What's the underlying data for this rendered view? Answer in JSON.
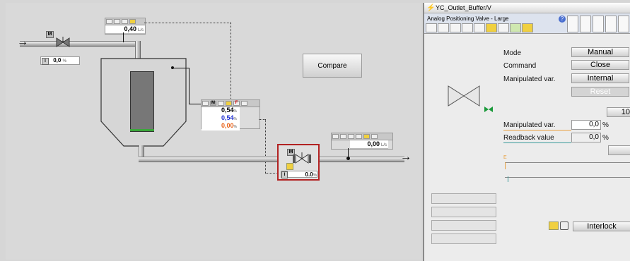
{
  "process": {
    "valve_inlet_mode": "M",
    "valve_inlet_value": "0,0",
    "valve_inlet_unit": "%",
    "flow_inlet_value": "0,40",
    "flow_inlet_unit": "L/s",
    "compare_label": "Compare",
    "tank_mode": "M",
    "tank_flag": "F",
    "tank_value_1": "0,54",
    "tank_value_2": "0,54",
    "tank_value_3": "0,00",
    "tank_unit": "%",
    "flow_outlet_value": "0,00",
    "flow_outlet_unit": "L/s",
    "valve_outlet_mode": "M",
    "valve_outlet_value": "0.0",
    "valve_outlet_unit": "%",
    "interlock_marker": "I",
    "colors": {
      "selection": "#b22222",
      "tank_level": "#3aa63a",
      "value_blue": "#1f2fd0",
      "value_orange": "#e8621a"
    }
  },
  "faceplate": {
    "title": "YC_Outlet_Buffer/V",
    "subtitle": "Analog Positioning Valve - Large",
    "mode_label": "Mode",
    "mode_value": "Manual",
    "command_label": "Command",
    "command_value": "Close",
    "manip_label": "Manipulated var.",
    "manip_value": "Internal",
    "reset_label": "Reset",
    "range_top": "10",
    "manip_var_label": "Manipulated var.",
    "manip_var_value": "0,0",
    "manip_var_unit": "%",
    "readback_label": "Readback value",
    "readback_value": "0,0",
    "readback_unit": "%",
    "bar_marker": "E",
    "interlock_label": "Interlock"
  }
}
